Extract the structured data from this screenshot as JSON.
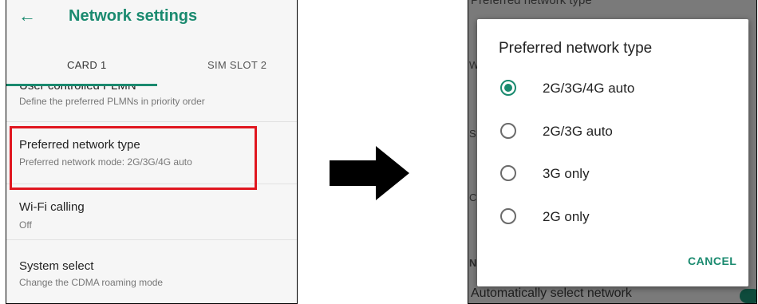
{
  "colors": {
    "accent": "#1a8a6f",
    "highlight": "#e0161f",
    "scrim": "#7a7a7a"
  },
  "left_screen": {
    "back_icon": "arrow-left-icon",
    "title": "Network settings",
    "tabs": [
      {
        "label": "CARD 1",
        "selected": true
      },
      {
        "label": "SIM SLOT 2",
        "selected": false
      }
    ],
    "items": [
      {
        "title": "",
        "subtitle": "Define the preferred PLMNs in priority order"
      },
      {
        "title": "Preferred network type",
        "subtitle": "Preferred network mode: 2G/3G/4G auto"
      },
      {
        "title": "Wi-Fi calling",
        "subtitle": "Off"
      },
      {
        "title": "System select",
        "subtitle": "Change the CDMA roaming mode"
      }
    ]
  },
  "right_screen": {
    "background": {
      "bottom_item": "Automatically select network"
    },
    "dialog": {
      "title": "Preferred network type",
      "options": [
        {
          "label": "2G/3G/4G auto",
          "selected": true
        },
        {
          "label": "2G/3G auto",
          "selected": false
        },
        {
          "label": "3G only",
          "selected": false
        },
        {
          "label": "2G only",
          "selected": false
        }
      ],
      "cancel_label": "CANCEL"
    }
  }
}
